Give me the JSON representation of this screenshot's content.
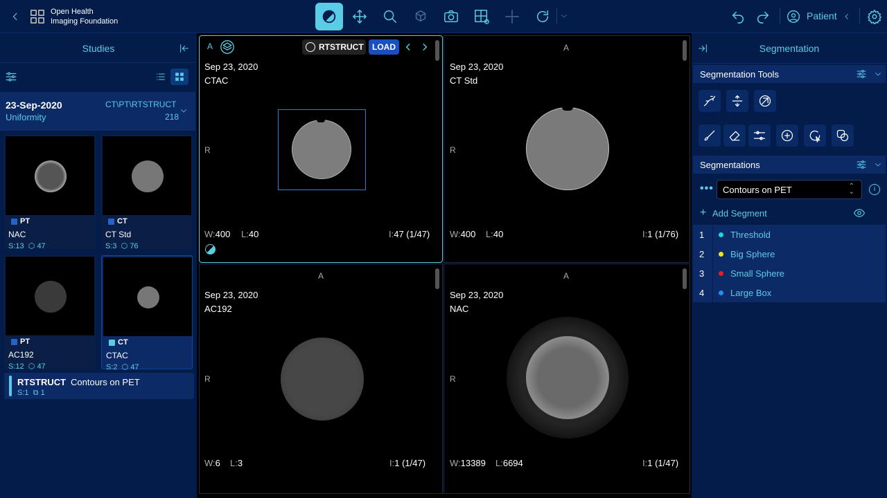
{
  "header": {
    "org_line1": "Open Health",
    "org_line2": "Imaging Foundation",
    "patient_label": "Patient",
    "tools": [
      "window-level-icon",
      "pan-icon",
      "zoom-icon",
      "3d-rotate-icon",
      "capture-icon",
      "layout-icon",
      "crosshair-icon",
      "reset-icon"
    ]
  },
  "studies_panel": {
    "title": "Studies",
    "study": {
      "date": "23-Sep-2020",
      "description": "Uniformity",
      "modalities": "CT\\PT\\RTSTRUCT",
      "count": "218"
    },
    "series": [
      {
        "modality": "PT",
        "mod_color": "#2563c6",
        "name": "NAC",
        "s": "S:13",
        "n": "47"
      },
      {
        "modality": "CT",
        "mod_color": "#2563c6",
        "name": "CT Std",
        "s": "S:3",
        "n": "76"
      },
      {
        "modality": "PT",
        "mod_color": "#2563c6",
        "name": "AC192",
        "s": "S:12",
        "n": "47"
      },
      {
        "modality": "CT",
        "mod_color": "#5acce6",
        "name": "CTAC",
        "s": "S:2",
        "n": "47"
      }
    ],
    "rtstruct": {
      "modality": "RTSTRUCT",
      "name": "Contours on PET",
      "s": "S:1",
      "n": "1"
    }
  },
  "viewports": [
    {
      "date": "Sep 23, 2020",
      "name": "CTAC",
      "orient_top": "",
      "orient_left": "R",
      "w": "400",
      "l": "40",
      "i": "47 (1/47)",
      "rt_label": "RTSTRUCT",
      "load_label": "LOAD",
      "mode_icon_label": "A"
    },
    {
      "date": "Sep 23, 2020",
      "name": "CT Std",
      "orient_top": "A",
      "orient_left": "R",
      "w": "400",
      "l": "40",
      "i": "1 (1/76)"
    },
    {
      "date": "Sep 23, 2020",
      "name": "AC192",
      "orient_top": "A",
      "orient_left": "R",
      "w": "6",
      "l": "3",
      "i": "1 (1/47)"
    },
    {
      "date": "Sep 23, 2020",
      "name": "NAC",
      "orient_top": "A",
      "orient_left": "R",
      "w": "13389",
      "l": "6694",
      "i": "1 (1/47)"
    }
  ],
  "overlay_labels": {
    "w": "W:",
    "l": "L:",
    "i": "I:"
  },
  "segmentation_panel": {
    "title": "Segmentation",
    "tools_title": "Segmentation Tools",
    "segmentations_title": "Segmentations",
    "selected": "Contours on PET",
    "add_segment": "Add Segment",
    "segments": [
      {
        "num": "1",
        "name": "Threshold",
        "color": "#1fd6d6"
      },
      {
        "num": "2",
        "name": "Big Sphere",
        "color": "#f5e31a"
      },
      {
        "num": "3",
        "name": "Small Sphere",
        "color": "#e81e1e"
      },
      {
        "num": "4",
        "name": "Large Box",
        "color": "#2a8cf0"
      }
    ]
  }
}
